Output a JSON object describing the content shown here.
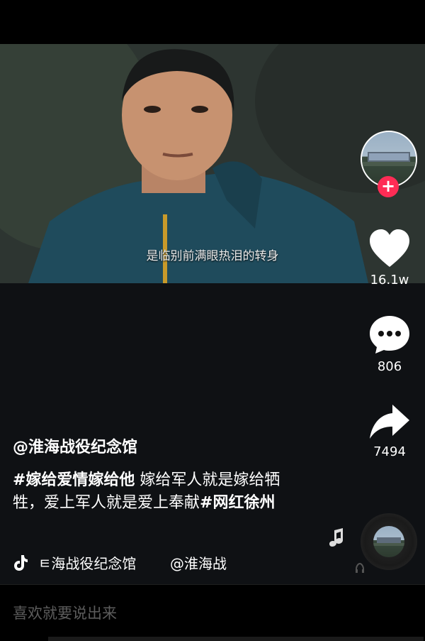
{
  "video": {
    "subtitle": "是临别前满眼热泪的转身"
  },
  "actions": {
    "like_count": "16.1w",
    "comment_count": "806",
    "share_count": "7494",
    "follow_symbol": "+"
  },
  "post": {
    "author": "@淮海战役纪念馆",
    "caption_parts": [
      "#嫁给爱情嫁给他",
      " 嫁给军人就是嫁给牺牲，爱上军人就是爱上奉献",
      "#网红徐州"
    ]
  },
  "music": {
    "title": "ㅌ海战役纪念馆",
    "tag": "@淮海战"
  },
  "comment_input": {
    "placeholder": "喜欢就要说出来"
  },
  "colors": {
    "accent": "#fe2c55",
    "background": "#000000"
  },
  "icons": [
    "heart-icon",
    "comment-icon",
    "share-icon",
    "tiktok-icon",
    "music-note-icon",
    "music-disc-icon"
  ]
}
